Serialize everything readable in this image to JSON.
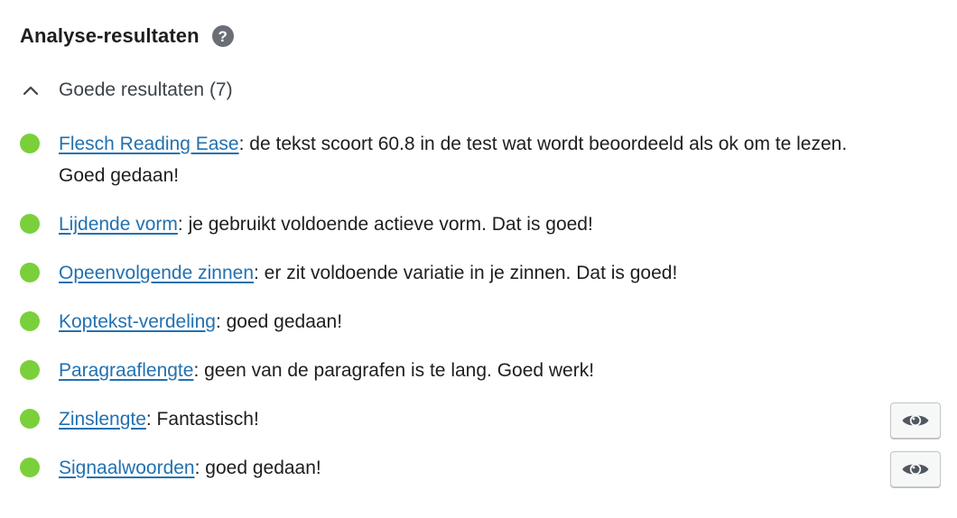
{
  "header": {
    "title": "Analyse-resultaten",
    "help_icon": "question-mark-icon",
    "help_glyph": "?"
  },
  "group": {
    "label": "Goede resultaten (7)",
    "chevron_icon": "chevron-up-icon",
    "expanded": true
  },
  "colors": {
    "good": "#7ad03a",
    "link": "#2271b1",
    "text": "#1e1e1e"
  },
  "results": [
    {
      "link": "Flesch Reading Ease",
      "text": ": de tekst scoort 60.8 in de test wat wordt beoordeeld als ok om te lezen. Goed gedaan!",
      "status": "good",
      "has_eye": false
    },
    {
      "link": "Lijdende vorm",
      "text": ": je gebruikt voldoende actieve vorm. Dat is goed!",
      "status": "good",
      "has_eye": false
    },
    {
      "link": "Opeenvolgende zinnen",
      "text": ": er zit voldoende variatie in je zinnen. Dat is goed!",
      "status": "good",
      "has_eye": false
    },
    {
      "link": "Koptekst-verdeling",
      "text": ": goed gedaan!",
      "status": "good",
      "has_eye": false
    },
    {
      "link": "Paragraaflengte",
      "text": ": geen van de paragrafen is te lang. Goed werk!",
      "status": "good",
      "has_eye": false
    },
    {
      "link": "Zinslengte",
      "text": ": Fantastisch!",
      "status": "good",
      "has_eye": true,
      "eye_icon": "eye-icon"
    },
    {
      "link": "Signaalwoorden",
      "text": ": goed gedaan!",
      "status": "good",
      "has_eye": true,
      "eye_icon": "eye-icon"
    }
  ]
}
